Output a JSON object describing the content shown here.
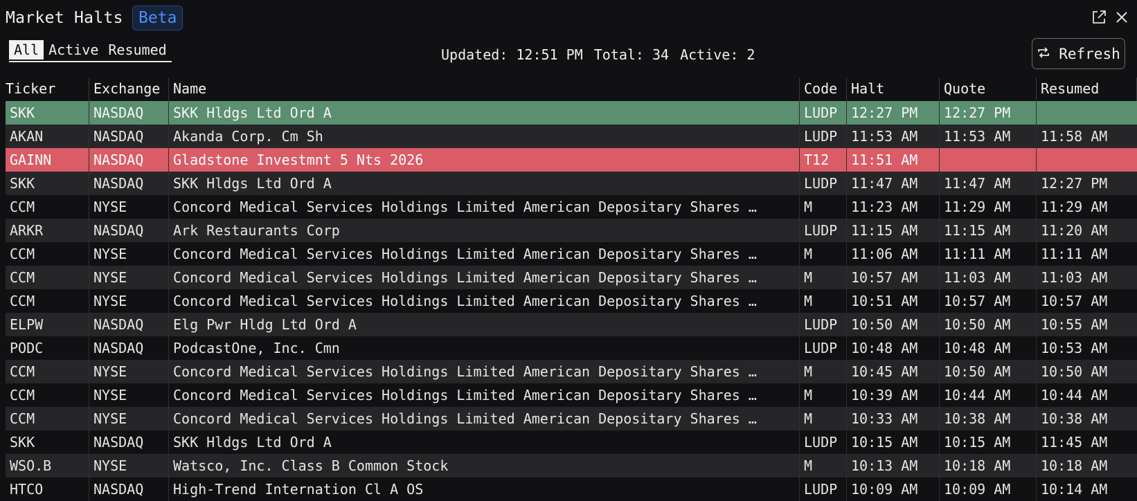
{
  "app": {
    "title": "Market Halts",
    "badge": "Beta",
    "icons": {
      "popout": "external-link-icon",
      "close": "close-icon",
      "refresh": "refresh-icon"
    }
  },
  "tabs": [
    {
      "label": "All",
      "active": true
    },
    {
      "label": "Active",
      "active": false
    },
    {
      "label": "Resumed",
      "active": false
    }
  ],
  "stats": {
    "updated": "Updated: 12:51 PM",
    "total": "Total: 34",
    "active": "Active: 2"
  },
  "refresh_label": "Refresh",
  "colors": {
    "active_row": "#5a8f70",
    "halted_row": "#d95c66",
    "badge_text": "#4f8ef5"
  },
  "table": {
    "columns": [
      "Ticker",
      "Exchange",
      "Name",
      "Code",
      "Halt",
      "Quote",
      "Resumed"
    ],
    "rows": [
      {
        "status": "active",
        "ticker": "SKK",
        "exchange": "NASDAQ",
        "name": "SKK Hldgs Ltd Ord A",
        "code": "LUDP",
        "halt": "12:27 PM",
        "quote": "12:27 PM",
        "resumed": ""
      },
      {
        "status": "",
        "ticker": "AKAN",
        "exchange": "NASDAQ",
        "name": "Akanda Corp. Cm Sh",
        "code": "LUDP",
        "halt": "11:53 AM",
        "quote": "11:53 AM",
        "resumed": "11:58 AM"
      },
      {
        "status": "halted",
        "ticker": "GAINN",
        "exchange": "NASDAQ",
        "name": "Gladstone Investmnt 5 Nts 2026",
        "code": "T12",
        "halt": "11:51 AM",
        "quote": "",
        "resumed": ""
      },
      {
        "status": "",
        "ticker": "SKK",
        "exchange": "NASDAQ",
        "name": "SKK Hldgs Ltd Ord A",
        "code": "LUDP",
        "halt": "11:47 AM",
        "quote": "11:47 AM",
        "resumed": "12:27 PM"
      },
      {
        "status": "",
        "ticker": "CCM",
        "exchange": "NYSE",
        "name": "Concord Medical Services Holdings Limited American Depositary Shares …",
        "code": "M",
        "halt": "11:23 AM",
        "quote": "11:29 AM",
        "resumed": "11:29 AM"
      },
      {
        "status": "",
        "ticker": "ARKR",
        "exchange": "NASDAQ",
        "name": "Ark Restaurants Corp",
        "code": "LUDP",
        "halt": "11:15 AM",
        "quote": "11:15 AM",
        "resumed": "11:20 AM"
      },
      {
        "status": "",
        "ticker": "CCM",
        "exchange": "NYSE",
        "name": "Concord Medical Services Holdings Limited American Depositary Shares …",
        "code": "M",
        "halt": "11:06 AM",
        "quote": "11:11 AM",
        "resumed": "11:11 AM"
      },
      {
        "status": "",
        "ticker": "CCM",
        "exchange": "NYSE",
        "name": "Concord Medical Services Holdings Limited American Depositary Shares …",
        "code": "M",
        "halt": "10:57 AM",
        "quote": "11:03 AM",
        "resumed": "11:03 AM"
      },
      {
        "status": "",
        "ticker": "CCM",
        "exchange": "NYSE",
        "name": "Concord Medical Services Holdings Limited American Depositary Shares …",
        "code": "M",
        "halt": "10:51 AM",
        "quote": "10:57 AM",
        "resumed": "10:57 AM"
      },
      {
        "status": "",
        "ticker": "ELPW",
        "exchange": "NASDAQ",
        "name": "Elg Pwr Hldg Ltd Ord A",
        "code": "LUDP",
        "halt": "10:50 AM",
        "quote": "10:50 AM",
        "resumed": "10:55 AM"
      },
      {
        "status": "",
        "ticker": "PODC",
        "exchange": "NASDAQ",
        "name": "PodcastOne, Inc. Cmn",
        "code": "LUDP",
        "halt": "10:48 AM",
        "quote": "10:48 AM",
        "resumed": "10:53 AM"
      },
      {
        "status": "",
        "ticker": "CCM",
        "exchange": "NYSE",
        "name": "Concord Medical Services Holdings Limited American Depositary Shares …",
        "code": "M",
        "halt": "10:45 AM",
        "quote": "10:50 AM",
        "resumed": "10:50 AM"
      },
      {
        "status": "",
        "ticker": "CCM",
        "exchange": "NYSE",
        "name": "Concord Medical Services Holdings Limited American Depositary Shares …",
        "code": "M",
        "halt": "10:39 AM",
        "quote": "10:44 AM",
        "resumed": "10:44 AM"
      },
      {
        "status": "",
        "ticker": "CCM",
        "exchange": "NYSE",
        "name": "Concord Medical Services Holdings Limited American Depositary Shares …",
        "code": "M",
        "halt": "10:33 AM",
        "quote": "10:38 AM",
        "resumed": "10:38 AM"
      },
      {
        "status": "",
        "ticker": "SKK",
        "exchange": "NASDAQ",
        "name": "SKK Hldgs Ltd Ord A",
        "code": "LUDP",
        "halt": "10:15 AM",
        "quote": "10:15 AM",
        "resumed": "11:45 AM"
      },
      {
        "status": "",
        "ticker": "WSO.B",
        "exchange": "NYSE",
        "name": "Watsco, Inc. Class B Common Stock",
        "code": "M",
        "halt": "10:13 AM",
        "quote": "10:18 AM",
        "resumed": "10:18 AM"
      },
      {
        "status": "",
        "ticker": "HTCO",
        "exchange": "NASDAQ",
        "name": "High-Trend Internation Cl A OS",
        "code": "LUDP",
        "halt": "10:09 AM",
        "quote": "10:09 AM",
        "resumed": "10:14 AM"
      }
    ]
  }
}
